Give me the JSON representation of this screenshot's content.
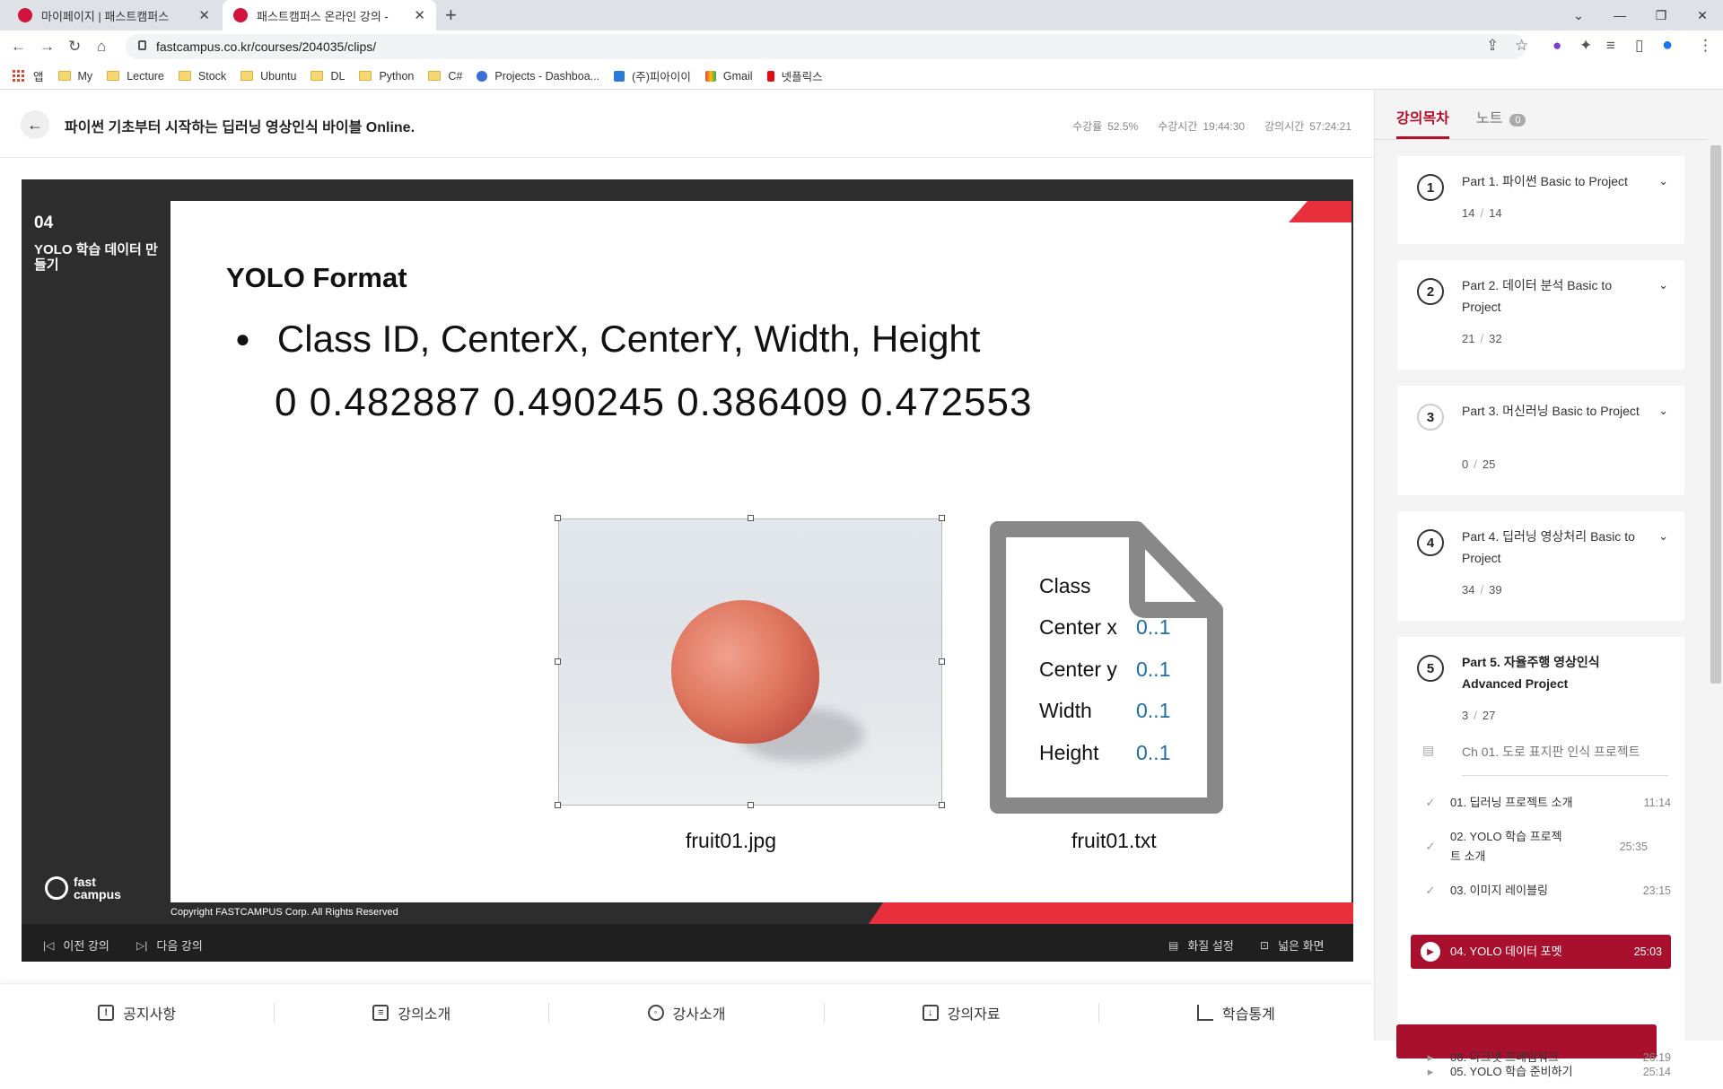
{
  "browser": {
    "tabs": [
      {
        "title": "마이페이지 | 패스트캠퍼스",
        "active": false
      },
      {
        "title": "패스트캠퍼스 온라인 강의 -",
        "active": true
      }
    ],
    "url": "fastcampus.co.kr/courses/204035/clips/",
    "bookmarks": [
      "앱",
      "My",
      "Lecture",
      "Stock",
      "Ubuntu",
      "DL",
      "Python",
      "C#",
      "Projects - Dashboa...",
      "(주)피아이이",
      "Gmail",
      "넷플릭스"
    ]
  },
  "course": {
    "title": "파이썬 기초부터 시작하는 딥러닝 영상인식 바이블 Online.",
    "progress_label": "수강률",
    "progress_value": "52.5%",
    "watched_label": "수강시간",
    "watched_value": "19:44:30",
    "total_label": "강의시간",
    "total_value": "57:24:21"
  },
  "slide": {
    "lesson_number": "04",
    "lesson_title": "YOLO 학습 데이터 만들기",
    "heading": "YOLO Format",
    "bullet": "Class ID, CenterX, CenterY, Width, Height",
    "values_line": "0 0.482887 0.490245 0.386409 0.472553",
    "image_caption": "fruit01.jpg",
    "text_caption": "fruit01.txt",
    "doc_rows": [
      {
        "key": "Class",
        "value": ""
      },
      {
        "key": "Center x",
        "value": "0..1"
      },
      {
        "key": "Center y",
        "value": "0..1"
      },
      {
        "key": "Width",
        "value": "0..1"
      },
      {
        "key": "Height",
        "value": "0..1"
      }
    ],
    "logo_line1": "fast",
    "logo_line2": "campus",
    "copyright": "Copyright FASTCAMPUS Corp. All Rights Reserved"
  },
  "controls": {
    "prev": "이전 강의",
    "next": "다음 강의",
    "quality": "화질 설정",
    "wide": "넓은 화면"
  },
  "bottom_nav": [
    "공지사항",
    "강의소개",
    "강사소개",
    "강의자료",
    "학습통계"
  ],
  "sidebar": {
    "tab_toc": "강의목차",
    "tab_notes": "노트",
    "notes_count": "0",
    "parts": [
      {
        "num": "1",
        "title": "Part 1. 파이썬 Basic to Project",
        "done": "14",
        "total": "14"
      },
      {
        "num": "2",
        "title": "Part 2. 데이터 분석 Basic to Project",
        "done": "21",
        "total": "32"
      },
      {
        "num": "3",
        "title": "Part 3. 머신러닝 Basic to Project",
        "done": "0",
        "total": "25"
      },
      {
        "num": "4",
        "title": "Part 4. 딥러닝 영상처리 Basic to Project",
        "done": "34",
        "total": "39"
      },
      {
        "num": "5",
        "title": "Part 5. 자율주행 영상인식 Advanced Project",
        "done": "3",
        "total": "27"
      }
    ],
    "chapter": "Ch 01. 도로 표지판 인식 프로젝트",
    "lessons": [
      {
        "title": "01. 딥러닝 프로젝트 소개",
        "duration": "11:14",
        "status": "done"
      },
      {
        "title": "02. YOLO 학습 프로젝트 소개",
        "duration": "25:35",
        "status": "done"
      },
      {
        "title": "03. 이미지 레이블링",
        "duration": "23:15",
        "status": "done"
      },
      {
        "title": "04. YOLO 데이터 포멧",
        "duration": "25:03",
        "status": "current"
      },
      {
        "title": "05. YOLO 학습 준비하기",
        "duration": "25:14",
        "status": "todo"
      },
      {
        "title": "06. 다크넷 프레임워크",
        "duration": "26:19",
        "status": "todo"
      }
    ]
  }
}
